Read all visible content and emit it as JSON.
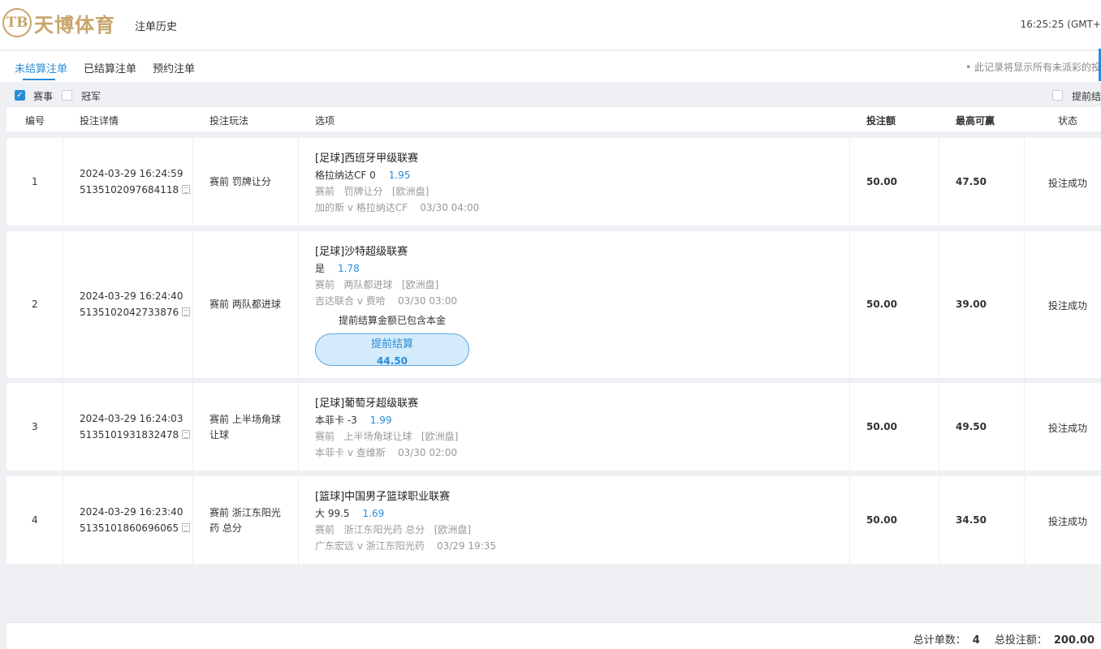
{
  "header": {
    "logo_mark": "TB",
    "logo_text": "天博体育",
    "title": "注单历史",
    "clock": "16:25:25 (GMT+"
  },
  "tabs": [
    {
      "label": "未结算注单",
      "active": true
    },
    {
      "label": "已结算注单",
      "active": false
    },
    {
      "label": "预约注单",
      "active": false
    }
  ],
  "notice": "• 此记录将显示所有未派彩的投",
  "filters": {
    "event_label": "赛事",
    "event_checked": true,
    "champion_label": "冠军",
    "champion_checked": false,
    "early_settle_label": "提前结"
  },
  "columns": {
    "no": "编号",
    "detail": "投注详情",
    "play": "投注玩法",
    "option": "选项",
    "stake": "投注额",
    "max_win": "最高可赢",
    "status": "状态"
  },
  "bets": [
    {
      "no": "1",
      "datetime": "2024-03-29 16:24:59",
      "bet_id": "5135102097684118",
      "play_lines": [
        "赛前 罚牌让分"
      ],
      "league": "[足球]西班牙甲级联赛",
      "pick": "格拉纳达CF 0",
      "odds": "1.95",
      "market": "赛前   罚牌让分   [欧洲盘]",
      "match": "加的斯 v 格拉纳达CF    03/30 04:00",
      "stake": "50.00",
      "max_win": "47.50",
      "status": "投注成功"
    },
    {
      "no": "2",
      "datetime": "2024-03-29 16:24:40",
      "bet_id": "5135102042733876",
      "play_lines": [
        "赛前 两队都进球"
      ],
      "league": "[足球]沙特超级联赛",
      "pick": "是",
      "odds": "1.78",
      "market": "赛前   两队都进球   [欧洲盘]",
      "match": "吉达联合 v 费哈    03/30 03:00",
      "cashout_note": "提前结算金额已包含本金",
      "cashout_label": "提前结算",
      "cashout_amount": "44.50",
      "stake": "50.00",
      "max_win": "39.00",
      "status": "投注成功"
    },
    {
      "no": "3",
      "datetime": "2024-03-29 16:24:03",
      "bet_id": "5135101931832478",
      "play_lines": [
        "赛前 上半场角球",
        "让球"
      ],
      "league": "[足球]葡萄牙超级联赛",
      "pick": "本菲卡 -3",
      "odds": "1.99",
      "market": "赛前   上半场角球让球   [欧洲盘]",
      "match": "本菲卡 v 查维斯    03/30 02:00",
      "stake": "50.00",
      "max_win": "49.50",
      "status": "投注成功"
    },
    {
      "no": "4",
      "datetime": "2024-03-29 16:23:40",
      "bet_id": "5135101860696065",
      "play_lines": [
        "赛前 浙江东阳光",
        "药 总分"
      ],
      "league": "[篮球]中国男子篮球职业联赛",
      "pick": "大 99.5",
      "odds": "1.69",
      "market": "赛前   浙江东阳光药 总分   [欧洲盘]",
      "match": "广东宏远 v 浙江东阳光药    03/29 19:35",
      "stake": "50.00",
      "max_win": "34.50",
      "status": "投注成功"
    }
  ],
  "footer": {
    "count_label": "总计单数：",
    "count": "4",
    "total_label": "总投注额：",
    "total": "200.00"
  },
  "colors": {
    "accent": "#2a8cd6",
    "brand_gold": "#c9a46b",
    "background": "#eef0f4"
  }
}
